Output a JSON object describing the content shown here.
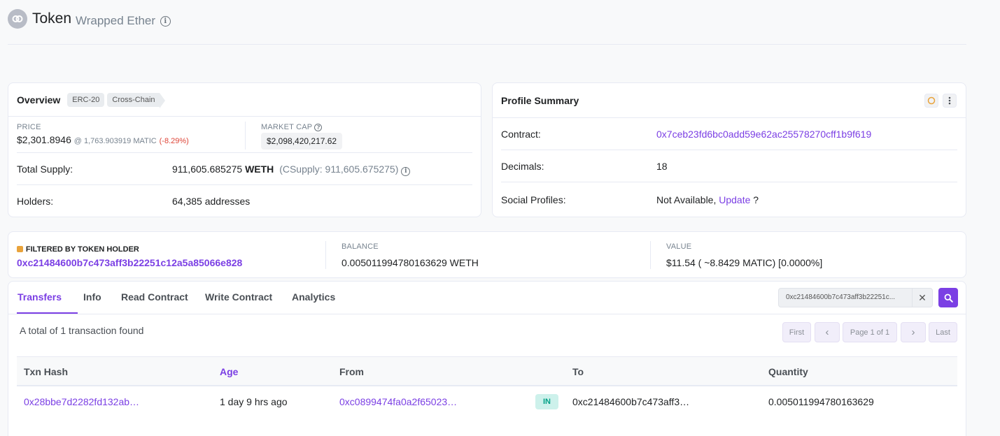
{
  "header": {
    "title": "Token",
    "subtitle": "Wrapped Ether",
    "info_icon": "info-circle-icon"
  },
  "overview": {
    "title": "Overview",
    "badges": [
      "ERC-20",
      "Cross-Chain"
    ],
    "price_label": "PRICE",
    "price_value": "$2,301.8946",
    "price_matic": "@ 1,763.903919 MATIC",
    "price_change": "(-8.29%)",
    "market_cap_label": "MARKET CAP",
    "market_cap_value": "$2,098,420,217.62",
    "total_supply_label": "Total Supply:",
    "total_supply_value": "911,605.685275",
    "total_supply_symbol": "WETH",
    "csupply": "(CSupply: 911,605.675275)",
    "holders_label": "Holders:",
    "holders_value": "64,385 addresses"
  },
  "profile": {
    "title": "Profile Summary",
    "contract_label": "Contract:",
    "contract_value": "0x7ceb23fd6bc0add59e62ac25578270cff1b9f619",
    "decimals_label": "Decimals:",
    "decimals_value": "18",
    "social_label": "Social Profiles:",
    "social_value": "Not Available,",
    "social_link": "Update",
    "social_q": "?"
  },
  "filter": {
    "label": "FILTERED BY TOKEN HOLDER",
    "address": "0xc21484600b7c473aff3b22251c12a5a85066e828",
    "balance_label": "BALANCE",
    "balance_value": "0.005011994780163629 WETH",
    "value_label": "VALUE",
    "value_value": "$11.54 ( ~8.8429 MATIC) [0.0000%]"
  },
  "tabs": [
    "Transfers",
    "Info",
    "Read Contract",
    "Write Contract",
    "Analytics"
  ],
  "search": {
    "value": "0xc21484600b7c473aff3b22251c..."
  },
  "transfers": {
    "summary": "A total of 1 transaction found",
    "pagination": {
      "first": "First",
      "prev": "‹",
      "page": "Page 1 of 1",
      "next": "›",
      "last": "Last"
    },
    "columns": [
      "Txn Hash",
      "Age",
      "From",
      "To",
      "Quantity"
    ],
    "rows": [
      {
        "hash": "0x28bbe7d2282fd132ab…",
        "age": "1 day 9 hrs ago",
        "from": "0xc0899474fa0a2f65023…",
        "direction": "IN",
        "to": "0xc21484600b7c473aff3…",
        "quantity": "0.005011994780163629"
      }
    ]
  },
  "colors": {
    "accent": "#7b3fe4",
    "negative": "#de4437",
    "in_badge_bg": "#cdf1eb",
    "in_badge_text": "#00a186"
  }
}
